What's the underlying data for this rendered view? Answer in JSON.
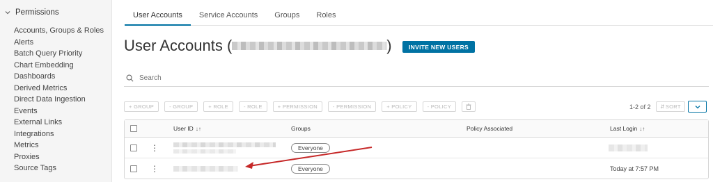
{
  "sidebar": {
    "header": "Permissions",
    "items": [
      {
        "label": "Accounts, Groups & Roles"
      },
      {
        "label": "Alerts"
      },
      {
        "label": "Batch Query Priority"
      },
      {
        "label": "Chart Embedding"
      },
      {
        "label": "Dashboards"
      },
      {
        "label": "Derived Metrics"
      },
      {
        "label": "Direct Data Ingestion"
      },
      {
        "label": "Events"
      },
      {
        "label": "External Links"
      },
      {
        "label": "Integrations"
      },
      {
        "label": "Metrics"
      },
      {
        "label": "Proxies"
      },
      {
        "label": "Source Tags"
      }
    ]
  },
  "tabs": [
    {
      "label": "User Accounts",
      "active": true
    },
    {
      "label": "Service Accounts"
    },
    {
      "label": "Groups"
    },
    {
      "label": "Roles"
    }
  ],
  "page": {
    "title_prefix": "User Accounts (",
    "title_suffix": ")",
    "invite_label": "INVITE NEW USERS"
  },
  "search": {
    "placeholder": "Search"
  },
  "actions": {
    "add_group": "+ GROUP",
    "remove_group": "- GROUP",
    "add_role": "+ ROLE",
    "remove_role": "- ROLE",
    "add_permission": "+ PERMISSION",
    "remove_permission": "- PERMISSION",
    "add_policy": "+ POLICY",
    "remove_policy": "- POLICY",
    "trash_icon": "trash-icon"
  },
  "pagination": {
    "count": "1-2 of 2",
    "sort_label": "SORT"
  },
  "table": {
    "headers": {
      "user_id": "User ID",
      "groups": "Groups",
      "policy": "Policy Associated",
      "last_login": "Last Login"
    },
    "rows": [
      {
        "group": "Everyone",
        "last_login": ""
      },
      {
        "group": "Everyone",
        "last_login": "Today at 7:57 PM"
      }
    ]
  },
  "colors": {
    "accent": "#0072a3",
    "annotation_arrow": "#c62828"
  }
}
